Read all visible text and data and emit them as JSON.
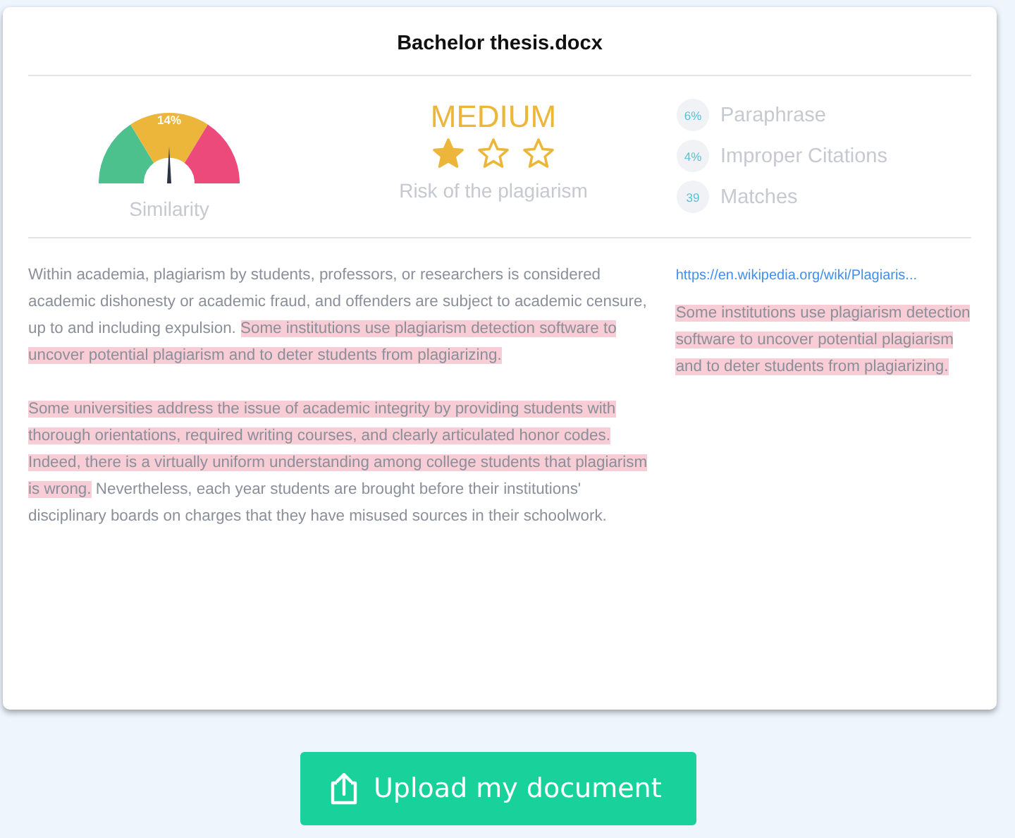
{
  "document": {
    "title": "Bachelor thesis.docx"
  },
  "similarity": {
    "value": "14%",
    "label": "Similarity"
  },
  "risk": {
    "level_text": "MEDIUM",
    "stars": 1,
    "label": "Risk of the plagiarism"
  },
  "stats": [
    {
      "value": "6%",
      "label": "Paraphrase"
    },
    {
      "value": "4%",
      "label": "Improper Citations"
    },
    {
      "value": "39",
      "label": "Matches"
    }
  ],
  "paragraphs": [
    {
      "segments": [
        {
          "text": "Within academia, plagiarism by students, professors, or researchers is considered academic dishonesty or academic fraud, and offenders are subject to academic censure, up to and including expulsion. ",
          "highlighted": false
        },
        {
          "text": "Some institutions use plagiarism detection software to uncover potential plagiarism and to deter students from plagiarizing.",
          "highlighted": true
        }
      ]
    },
    {
      "segments": [
        {
          "text": "Some universities address the issue of academic integrity by providing students with thorough orientations, required writing courses, and clearly articulated honor codes. Indeed, there is a virtually uniform understanding among college students that plagiarism is wrong.",
          "highlighted": true
        },
        {
          "text": " Nevertheless, each year students are brought before their institutions' disciplinary boards on charges that they have misused sources in their schoolwork.",
          "highlighted": false
        }
      ]
    }
  ],
  "source": {
    "url": "https://en.wikipedia.org/wiki/Plagiaris...",
    "excerpt": "Some institutions use plagiarism detection software to uncover potential plagiarism and to deter students from plagiarizing."
  },
  "upload_button": {
    "label": "Upload my document"
  }
}
